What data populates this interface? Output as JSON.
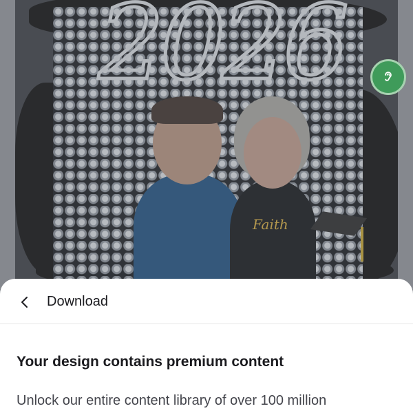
{
  "design": {
    "year_text": "2026",
    "shirt_text": "Faith"
  },
  "accessibility_button": {
    "icon": "ear-icon",
    "color": "#3f9b5a"
  },
  "sheet": {
    "back_icon": "chevron-left-icon",
    "header_title": "Download",
    "title": "Your design contains premium content",
    "body": "Unlock our entire content library of over 100 million"
  }
}
